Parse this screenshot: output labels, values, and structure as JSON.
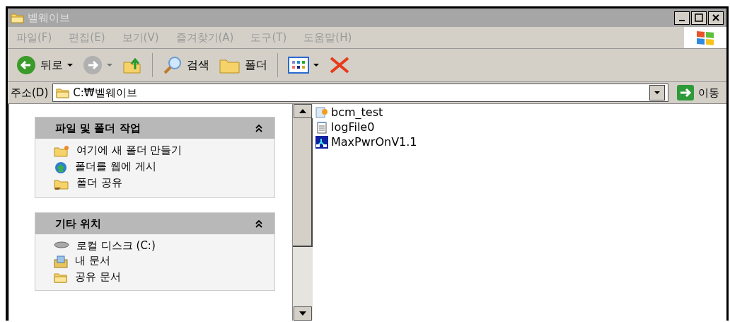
{
  "window": {
    "title": "벨웨이브",
    "active": false
  },
  "menu": [
    "파일(F)",
    "편집(E)",
    "보기(V)",
    "즐겨찾기(A)",
    "도구(T)",
    "도움말(H)"
  ],
  "toolbar": {
    "back": "뒤로",
    "search": "검색",
    "folders": "폴더"
  },
  "address": {
    "label": "주소(D)",
    "value": "C:₩벨웨이브",
    "go": "이동"
  },
  "panels": [
    {
      "title": "파일 및 폴더 작업",
      "expanded": true,
      "items": [
        {
          "kind": "new-folder",
          "label": "여기에 새 폴더 만들기"
        },
        {
          "kind": "publish",
          "label": "폴더를 웹에 게시"
        },
        {
          "kind": "share",
          "label": "폴더 공유"
        }
      ]
    },
    {
      "title": "기타 위치",
      "expanded": true,
      "items": [
        {
          "kind": "drive",
          "label": "로컬 디스크 (C:)"
        },
        {
          "kind": "documents",
          "label": "내 문서"
        },
        {
          "kind": "folder",
          "label": "공유 문서"
        }
      ]
    }
  ],
  "files": [
    {
      "kind": "batch",
      "name": "bcm_test"
    },
    {
      "kind": "text",
      "name": "logFile0"
    },
    {
      "kind": "app",
      "name": "MaxPwrOnV1.1"
    }
  ]
}
